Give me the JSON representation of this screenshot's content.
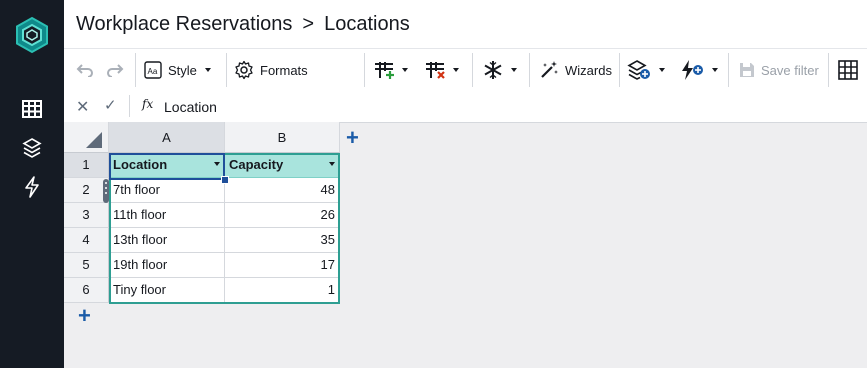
{
  "breadcrumb": {
    "parent": "Workplace Reservations",
    "separator": ">",
    "current": "Locations"
  },
  "toolbar": {
    "style_label": "Style",
    "formats_label": "Formats",
    "wizards_label": "Wizards",
    "save_filter_label": "Save filter"
  },
  "formula": {
    "fx_label": "fx",
    "value": "Location"
  },
  "columns": [
    "A",
    "B"
  ],
  "rows": [
    "1",
    "2",
    "3",
    "4",
    "5",
    "6"
  ],
  "table": {
    "headers": [
      "Location",
      "Capacity"
    ],
    "data": [
      [
        "7th floor",
        "48"
      ],
      [
        "11th floor",
        "26"
      ],
      [
        "13th floor",
        "35"
      ],
      [
        "19th floor",
        "17"
      ],
      [
        "Tiny floor",
        "1"
      ]
    ]
  },
  "colors": {
    "sidebar": "#151b24",
    "table_header": "#a9e4dd",
    "table_border": "#2e9e92",
    "accent": "#1a5ba8"
  },
  "icons": [
    "logo-icon",
    "grid-icon",
    "layers-icon",
    "lightning-icon",
    "undo-icon",
    "redo-icon",
    "style-icon",
    "gear-icon",
    "add-column-icon",
    "remove-column-icon",
    "snowflake-icon",
    "wand-icon",
    "add-layer-icon",
    "add-action-icon",
    "save-icon",
    "table-grid-icon"
  ]
}
